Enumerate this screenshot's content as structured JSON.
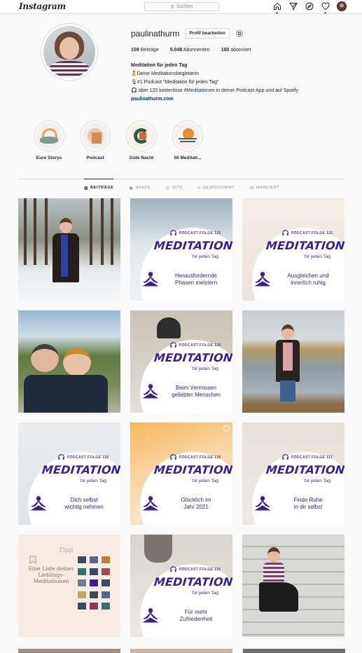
{
  "app": {
    "logo": "Instagram"
  },
  "search": {
    "placeholder": "Suchen",
    "icon": "search-icon"
  },
  "nav": {
    "icons": [
      "home-icon",
      "direct-icon",
      "explore-icon",
      "activity-icon",
      "profile-avatar"
    ]
  },
  "profile": {
    "username": "paulinathurm",
    "edit_button": "Profil bearbeiten",
    "stats": {
      "posts_count": "159",
      "posts_label": "Beiträge",
      "followers_count": "5.048",
      "followers_label": "Abonnenten",
      "following_count": "100",
      "following_label": "abonniert"
    },
    "bio": {
      "name": "Meditation für jeden Tag",
      "line1": "🧘Deine Meditationsbegleiterin",
      "line2_prefix": "🎙",
      "line2_hashtag": "#1",
      "line2_rest": " Podcast \"Meditation für jeden Tag\"",
      "line3_prefix": "🎧 über 120 kostenlose ",
      "line3_hashtag": "#Meditationen",
      "line3_rest": " in deiner Podcast-App und auf Spotify",
      "link": "paulinathurm.com"
    }
  },
  "highlights": [
    {
      "label": "Eure Storys"
    },
    {
      "label": "Podcast"
    },
    {
      "label": "Gute Nacht"
    },
    {
      "label": "50 Meditati..."
    }
  ],
  "tabs": [
    {
      "icon": "grid-icon",
      "label": "BEITRÄGE",
      "active": true
    },
    {
      "icon": "reels-icon",
      "label": "REELS"
    },
    {
      "icon": "igtv-icon",
      "label": "IGTV"
    },
    {
      "icon": "saved-icon",
      "label": "GESPEICHERT"
    },
    {
      "icon": "tagged-icon",
      "label": "MARKIERT"
    }
  ],
  "podcast": {
    "series": "MEDITATION",
    "subtitle": "für jeden Tag"
  },
  "posts": {
    "p1": {
      "folge": "PODCAST FOLGE 122",
      "title_l1": "Herausfordernde",
      "title_l2": "Phasen meistern"
    },
    "p2": {
      "folge": "PODCAST FOLGE 121",
      "title_l1": "Ausgleichen und",
      "title_l2": "innerlich ruhig"
    },
    "p3": {
      "folge": "PODCAST FOLGE 120",
      "title_l1": "Beim Vermissen",
      "title_l2": "geliebter Menschen"
    },
    "p4": {
      "folge": "PODCAST FOLGE 119",
      "title_l1": "Dich selbst",
      "title_l2": "wichtig nehmen"
    },
    "p5": {
      "folge": "PODCAST FOLGE 118",
      "title_l1": "Glücklich im",
      "title_l2": "Jahr 2021"
    },
    "p6": {
      "folge": "PODCAST FOLGE 117",
      "title_l1": "Finde Ruhe",
      "title_l2": "in dir selbst"
    },
    "p7": {
      "folge": "PODCAST FOLGE 116",
      "title_l1": "Für mehr",
      "title_l2": "Zufriedenheit"
    },
    "tipp": {
      "word": "Tipp",
      "title": "Eine Liste deiner Lieblings-Meditationen"
    }
  }
}
